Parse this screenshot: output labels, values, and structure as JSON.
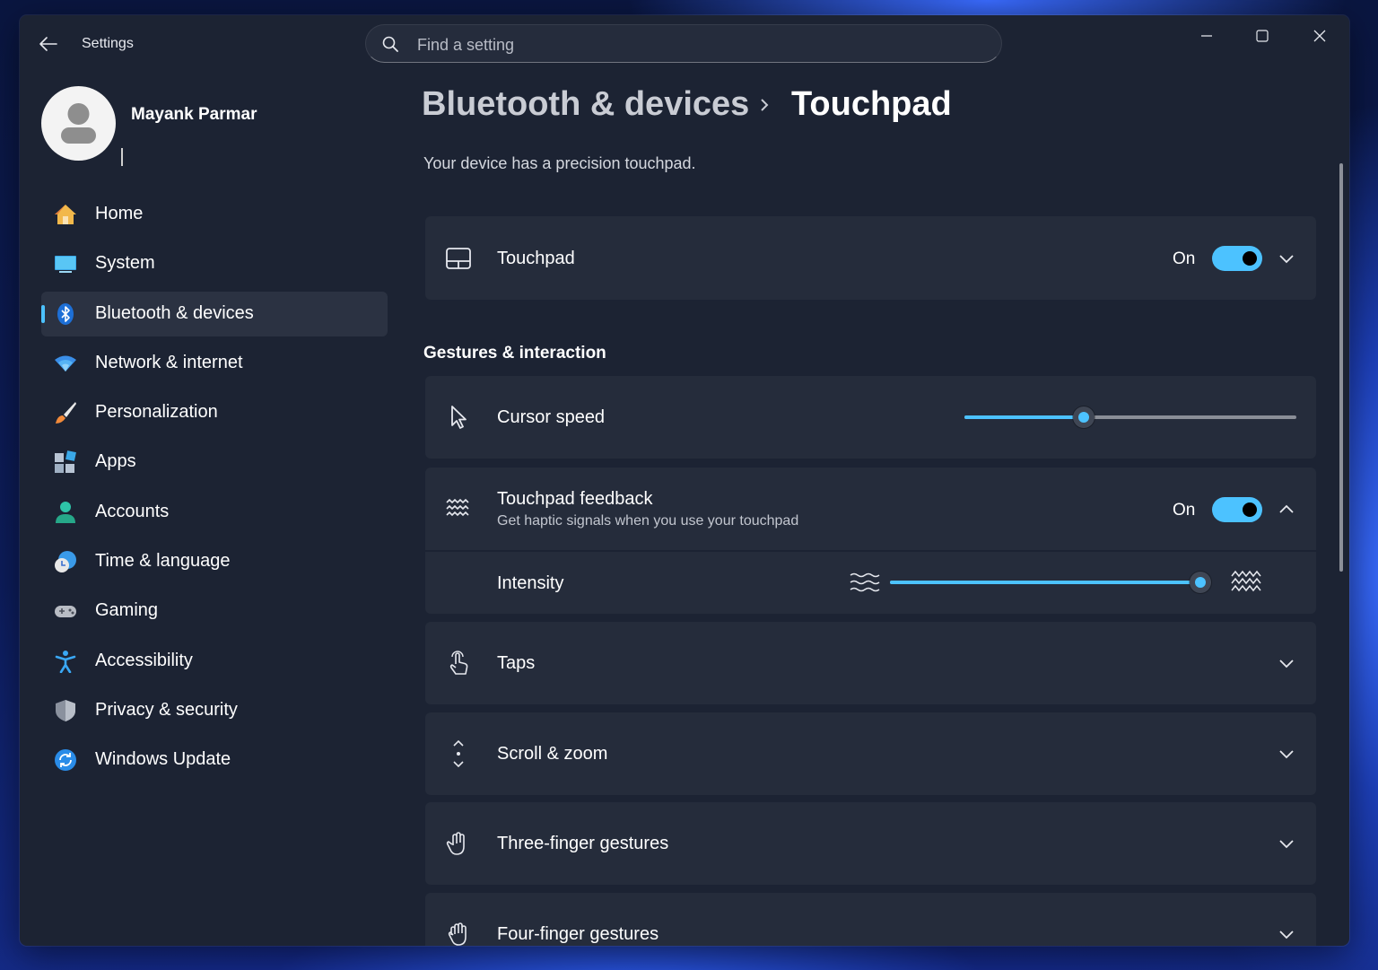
{
  "window": {
    "app_title": "Settings",
    "back_icon": "back-arrow-icon",
    "controls": [
      "minimize-icon",
      "maximize-icon",
      "close-icon"
    ]
  },
  "search": {
    "placeholder": "Find a setting",
    "value": ""
  },
  "profile": {
    "name": "Mayank Parmar"
  },
  "sidebar": {
    "items": [
      {
        "label": "Home",
        "icon": "home-icon"
      },
      {
        "label": "System",
        "icon": "monitor-icon"
      },
      {
        "label": "Bluetooth & devices",
        "icon": "bluetooth-icon",
        "selected": true
      },
      {
        "label": "Network & internet",
        "icon": "wifi-icon"
      },
      {
        "label": "Personalization",
        "icon": "brush-icon"
      },
      {
        "label": "Apps",
        "icon": "apps-icon"
      },
      {
        "label": "Accounts",
        "icon": "accounts-icon"
      },
      {
        "label": "Time & language",
        "icon": "time-language-icon"
      },
      {
        "label": "Gaming",
        "icon": "gamepad-icon"
      },
      {
        "label": "Accessibility",
        "icon": "accessibility-icon"
      },
      {
        "label": "Privacy & security",
        "icon": "shield-icon"
      },
      {
        "label": "Windows Update",
        "icon": "refresh-icon"
      }
    ]
  },
  "breadcrumb": {
    "parent": "Bluetooth & devices",
    "current": "Touchpad"
  },
  "description": "Your device has a precision touchpad.",
  "touchpad": {
    "label": "Touchpad",
    "state": "On",
    "enabled": true
  },
  "gestures_section": {
    "title": "Gestures & interaction"
  },
  "cursor_speed": {
    "label": "Cursor speed",
    "value_fraction": 0.35
  },
  "feedback": {
    "label": "Touchpad feedback",
    "sublabel": "Get haptic signals when you use your touchpad",
    "state": "On",
    "enabled": true,
    "intensity": {
      "label": "Intensity",
      "value_fraction": 1.0
    }
  },
  "sections": [
    {
      "label": "Taps",
      "icon": "tap-icon"
    },
    {
      "label": "Scroll & zoom",
      "icon": "scroll-icon"
    },
    {
      "label": "Three-finger gestures",
      "icon": "three-finger-icon"
    },
    {
      "label": "Four-finger gestures",
      "icon": "four-finger-icon"
    }
  ],
  "colors": {
    "accent": "#4cc2ff",
    "window_bg": "#1c2333",
    "card_bg": "#252c3b"
  }
}
